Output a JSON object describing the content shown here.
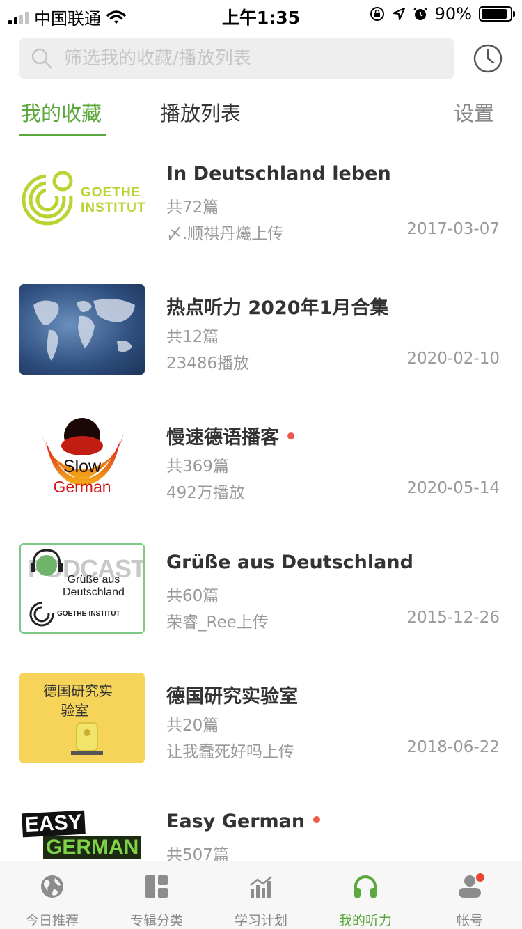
{
  "status_bar": {
    "carrier": "中国联通",
    "time": "上午1:35",
    "battery": "90%",
    "battery_level": 0.9
  },
  "search": {
    "placeholder": "筛选我的收藏/播放列表"
  },
  "tabs": {
    "favorites": "我的收藏",
    "playlist": "播放列表",
    "settings": "设置"
  },
  "items": [
    {
      "title": "In Deutschland leben",
      "count": "共72篇",
      "meta": "〆.顺祺丹爔上传",
      "date": "2017-03-07",
      "new": false,
      "thumb_text": "GOETHE INSTITUT"
    },
    {
      "title": "热点听力 2020年1月合集",
      "count": "共12篇",
      "meta": "23486播放",
      "date": "2020-02-10",
      "new": false,
      "thumb_text": ""
    },
    {
      "title": "慢速德语播客",
      "count": "共369篇",
      "meta": "492万播放",
      "date": "2020-05-14",
      "new": true,
      "thumb_text": "Slow German"
    },
    {
      "title": "Grüße aus Deutschland",
      "count": "共60篇",
      "meta": "荣睿_Ree上传",
      "date": "2015-12-26",
      "new": false,
      "thumb_text": "PODCAST Grüße aus Deutschland GOETHE-INSTITUT"
    },
    {
      "title": "德国研究实验室",
      "count": "共20篇",
      "meta": "让我蠢死好吗上传",
      "date": "2018-06-22",
      "new": false,
      "thumb_text": "德国研究实验室"
    },
    {
      "title": "Easy German",
      "count": "共507篇",
      "meta": "",
      "date": "",
      "new": true,
      "thumb_text": "EASY GERMAN"
    }
  ],
  "nav": [
    {
      "label": "今日推荐",
      "icon": "globe-icon"
    },
    {
      "label": "专辑分类",
      "icon": "grid-icon"
    },
    {
      "label": "学习计划",
      "icon": "chart-icon"
    },
    {
      "label": "我的听力",
      "icon": "headphones-icon"
    },
    {
      "label": "帐号",
      "icon": "user-icon"
    }
  ],
  "colors": {
    "accent": "#5ca83c",
    "new_dot": "#ee5a4b"
  }
}
